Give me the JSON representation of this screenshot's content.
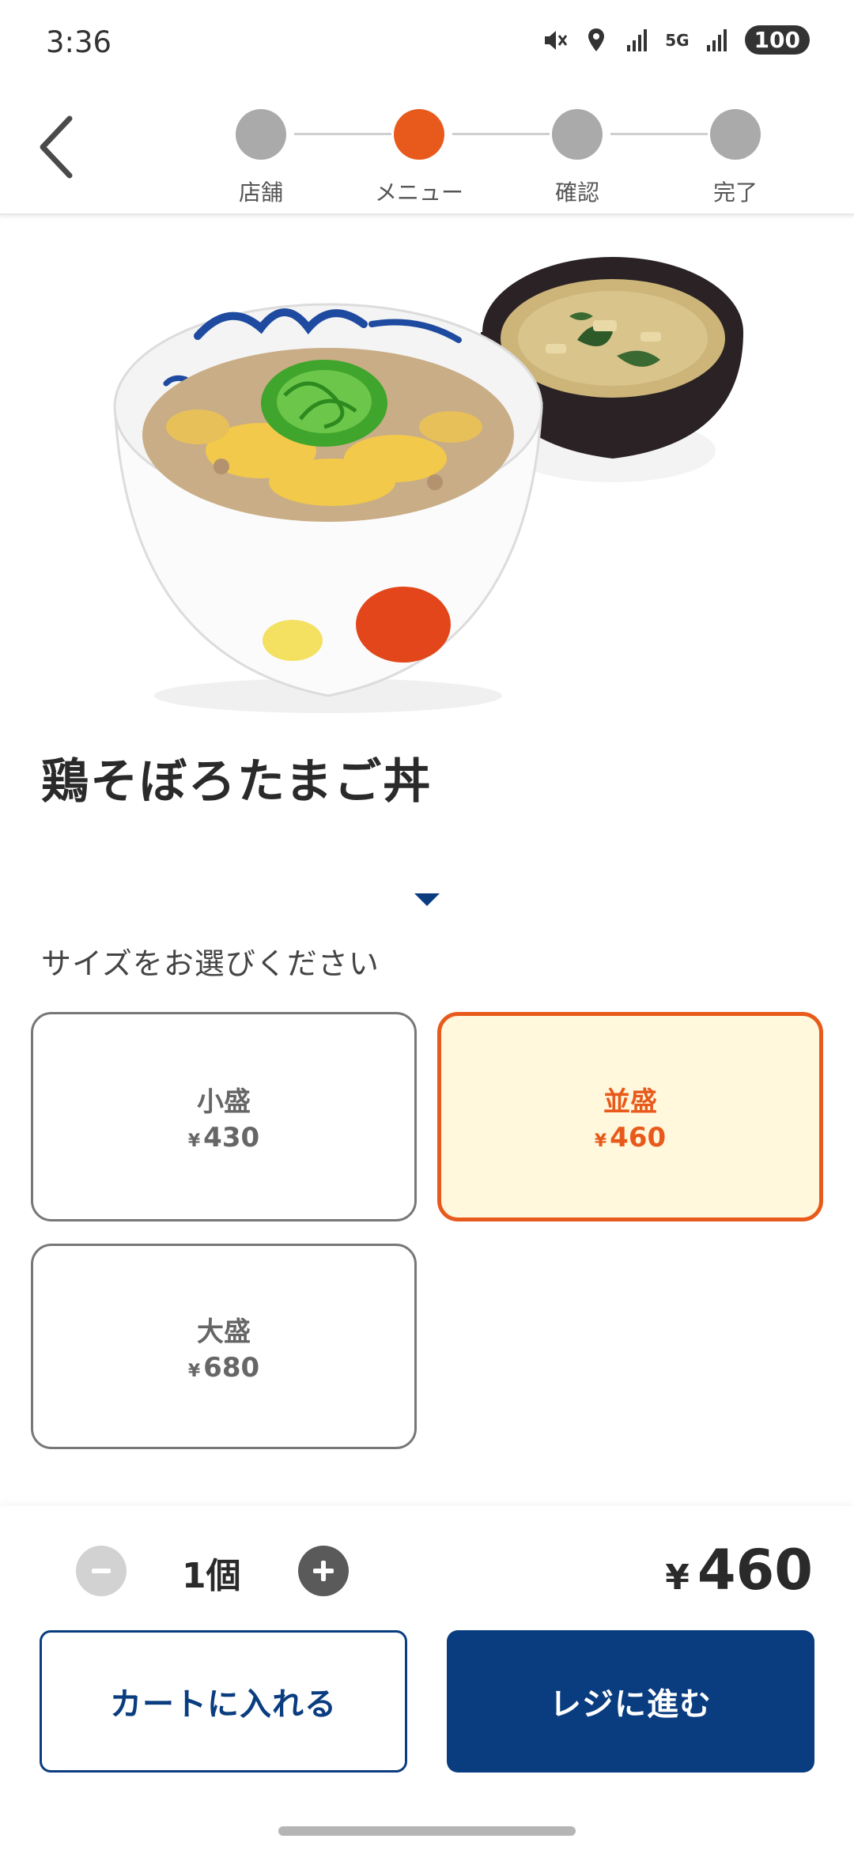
{
  "status_bar": {
    "time": "3:36",
    "network_label": "5G",
    "battery": "100",
    "icons": [
      "mute-icon",
      "location-icon",
      "signal-icon",
      "5g-icon",
      "signal-icon",
      "battery-icon"
    ]
  },
  "header": {
    "back_icon": "chevron-left-icon",
    "steps": [
      {
        "label": "店舗",
        "active": false
      },
      {
        "label": "メニュー",
        "active": true
      },
      {
        "label": "確認",
        "active": false
      },
      {
        "label": "完了",
        "active": false
      }
    ]
  },
  "product": {
    "name": "鶏そぼろたまご丼"
  },
  "size_section": {
    "prompt": "サイズをお選びください",
    "options": [
      {
        "name": "小盛",
        "currency": "¥",
        "price": "430",
        "selected": false
      },
      {
        "name": "並盛",
        "currency": "¥",
        "price": "460",
        "selected": true
      },
      {
        "name": "大盛",
        "currency": "¥",
        "price": "680",
        "selected": false
      }
    ]
  },
  "order": {
    "quantity_label": "1個",
    "total_currency": "¥",
    "total_price": "460",
    "minus_icon": "minus-icon",
    "plus_icon": "plus-icon",
    "add_to_cart_label": "カートに入れる",
    "checkout_label": "レジに進む"
  },
  "colors": {
    "accent": "#e85a1c",
    "primary": "#0a3d80",
    "selected_bg": "#fff8dc",
    "inactive_step": "#aaaaaa"
  }
}
